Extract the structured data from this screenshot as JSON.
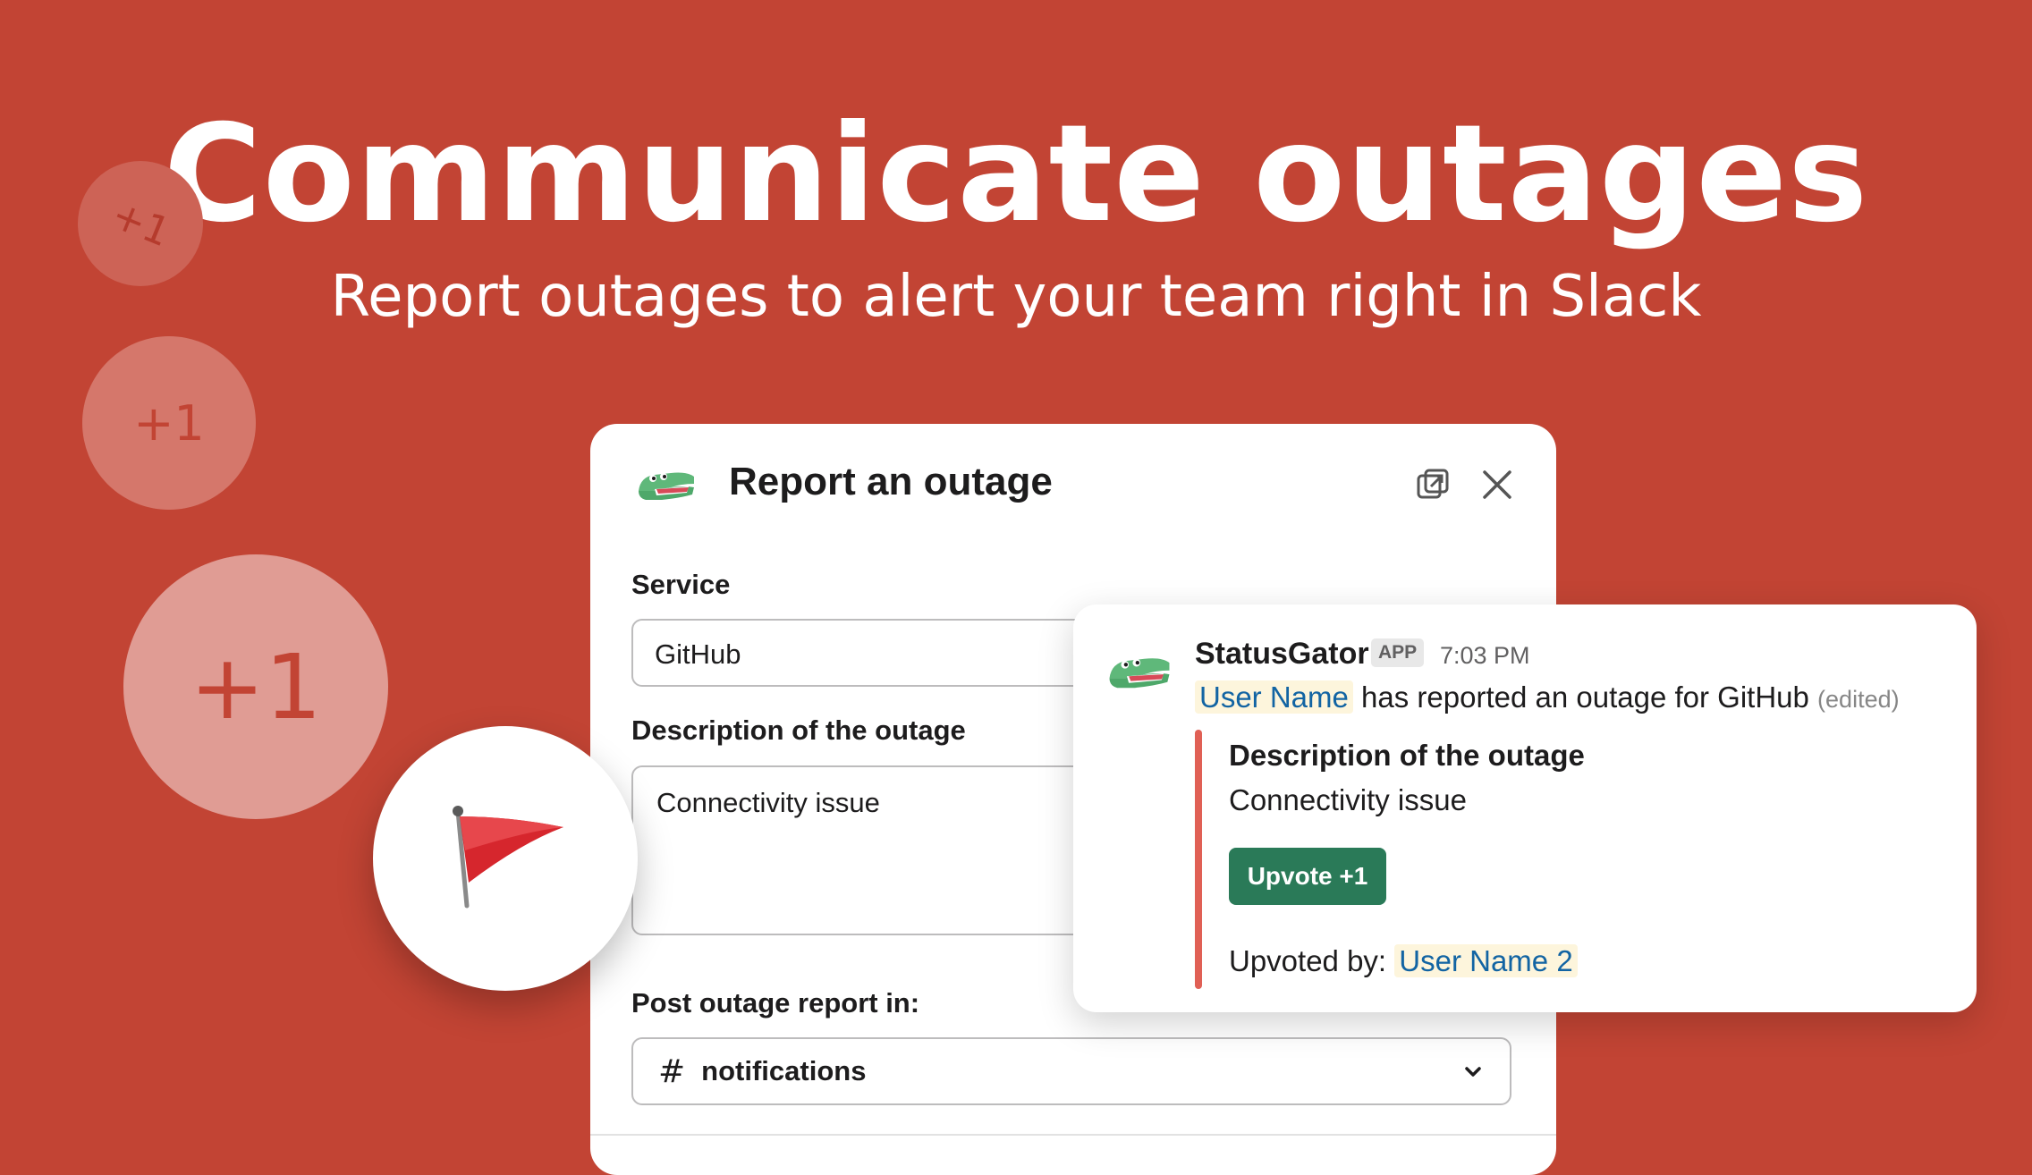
{
  "hero": {
    "title": "Communicate outages",
    "subtitle": "Report outages to alert your team right in Slack"
  },
  "bubbles": [
    "+1",
    "+1",
    "+1"
  ],
  "flag_icon": "red-flag-icon",
  "modal": {
    "title": "Report an outage",
    "logo_icon": "gator-icon",
    "popout_icon": "popout-icon",
    "close_icon": "close-icon",
    "service_label": "Service",
    "service_value": "GitHub",
    "description_label": "Description of the outage",
    "description_value": "Connectivity issue",
    "channel_label": "Post outage report in:",
    "channel_prefix": "#",
    "channel_value": "notifications"
  },
  "message": {
    "sender": "StatusGator",
    "badge": "APP",
    "time": "7:03 PM",
    "mention": "User Name",
    "text": "has reported an outage for GitHub",
    "edited": "(edited)",
    "attachment_title": "Description of the outage",
    "attachment_text": "Connectivity issue",
    "upvote_label": "Upvote +1",
    "upvoted_by_label": "Upvoted by:",
    "upvoted_by_user": "User Name 2"
  },
  "colors": {
    "background": "#c24434",
    "upvote_button": "#2a7a58",
    "attachment_bar": "#e06055",
    "mention_bg": "#fdf5dc",
    "mention_text": "#1264a3"
  }
}
